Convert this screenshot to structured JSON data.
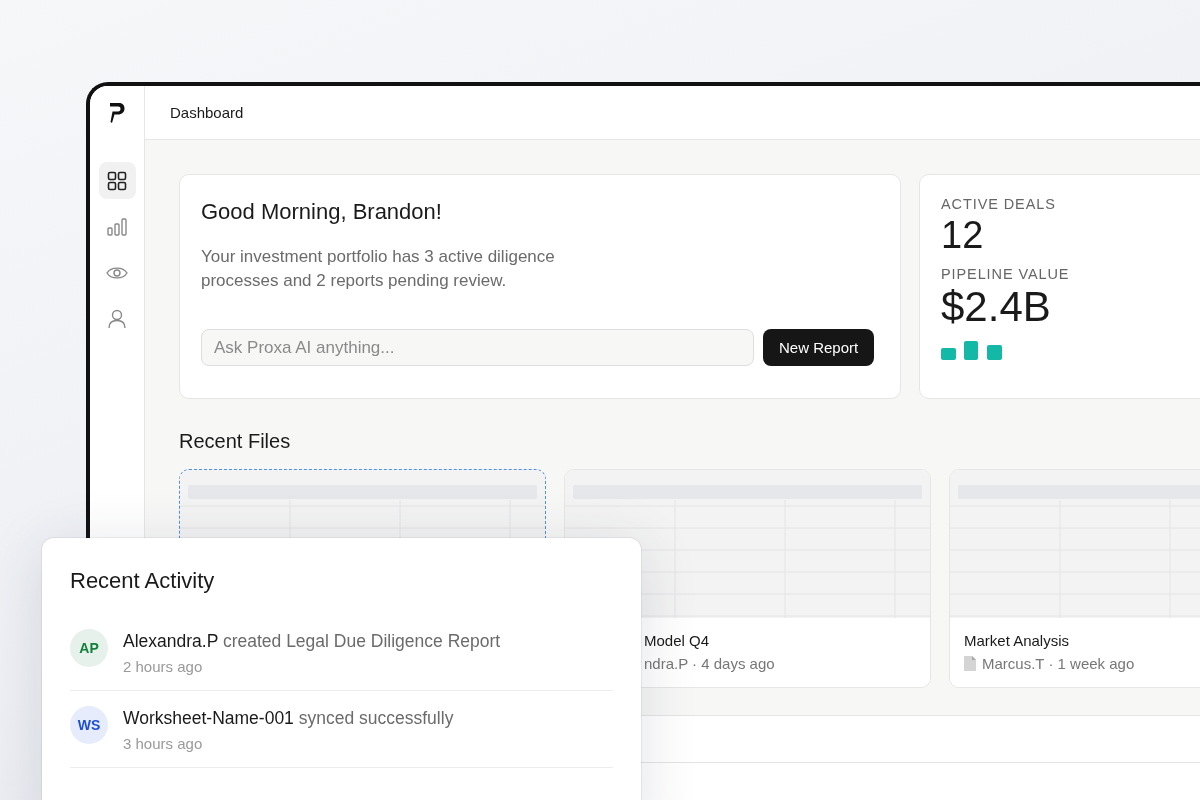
{
  "sidebar": {
    "items": [
      {
        "kind": "grid",
        "selected": true
      },
      {
        "kind": "bars",
        "selected": false
      },
      {
        "kind": "eye",
        "selected": false
      },
      {
        "kind": "user",
        "selected": false
      }
    ]
  },
  "topbar": {
    "title": "Dashboard"
  },
  "welcome": {
    "title": "Good Morning, Brandon!",
    "text": "Your investment portfolio has 3 active diligence processes and 2 reports pending review.",
    "search": {
      "placeholder": "Ask Proxa AI anything..."
    },
    "button": "New Report"
  },
  "stats": [
    {
      "label": "ACTIVE DEALS",
      "value": "12"
    },
    {
      "label": "PIPELINE VALUE",
      "value": "$2.4B"
    }
  ],
  "recent_files": {
    "title": "Recent Files",
    "files": [
      {
        "selected": true
      },
      {
        "selected": false,
        "partly_hidden": true,
        "icon": false,
        "title": "Model Q4",
        "meta": "ndra.P · 4 days ago"
      },
      {
        "selected": false,
        "partly_hidden": false,
        "icon": true,
        "title": "Market Analysis",
        "meta": "Marcus.T · 1 week ago"
      }
    ]
  },
  "activity": {
    "title": "Recent Activity",
    "items": [
      {
        "initials": "AP",
        "color": "#15803d",
        "actor": "Alexandra.P",
        "action": "created Legal Due Diligence Report",
        "time": "2 hours ago"
      },
      {
        "initials": "WS",
        "color": "#1d4ed8",
        "actor": "Worksheet-Name-001",
        "action": "synced successfully",
        "time": "3 hours ago"
      }
    ]
  }
}
